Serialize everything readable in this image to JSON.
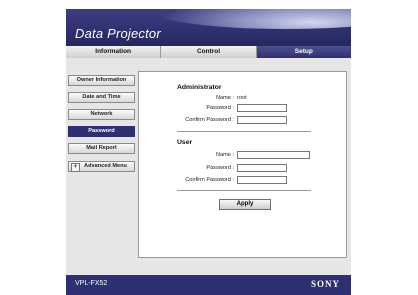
{
  "app": {
    "title": "Data Projector"
  },
  "tabs": [
    {
      "label": "Information"
    },
    {
      "label": "Control"
    },
    {
      "label": "Setup"
    }
  ],
  "sidebar": {
    "items": [
      {
        "label": "Owner Information"
      },
      {
        "label": "Date and Time"
      },
      {
        "label": "Network"
      },
      {
        "label": "Password"
      },
      {
        "label": "Mail Report"
      },
      {
        "label": "Advanced Menu",
        "expand_symbol": "+"
      }
    ]
  },
  "administrator": {
    "heading": "Administrator",
    "name_label": "Name :",
    "name_value": "root",
    "password_label": "Password :",
    "confirm_label": "Confirm Password :"
  },
  "user": {
    "heading": "User",
    "name_label": "Name :",
    "password_label": "Password :",
    "confirm_label": "Confirm Password :"
  },
  "apply_label": "Apply",
  "footer": {
    "model": "VPL-FX52",
    "brand": "SONY"
  },
  "colors": {
    "accent": "#2f3072",
    "active_tab": "#3e3f84",
    "panel_bg": "#e6e6e6"
  }
}
